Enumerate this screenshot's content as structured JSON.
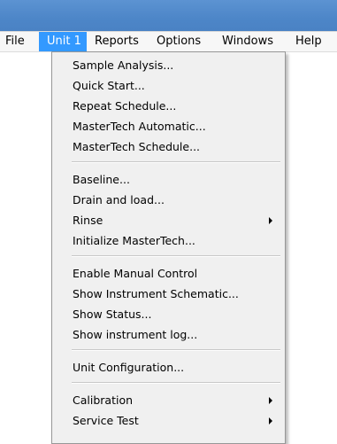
{
  "menubar": {
    "items": [
      {
        "label": "File"
      },
      {
        "label": "Unit 1"
      },
      {
        "label": "Reports"
      },
      {
        "label": "Options"
      },
      {
        "label": "Windows"
      },
      {
        "label": "Help"
      }
    ],
    "active_index": 1
  },
  "dropdown": {
    "items": [
      {
        "label": "Sample Analysis..."
      },
      {
        "label": "Quick Start..."
      },
      {
        "label": "Repeat Schedule..."
      },
      {
        "label": "MasterTech Automatic..."
      },
      {
        "label": "MasterTech Schedule..."
      },
      {
        "label": "Baseline..."
      },
      {
        "label": "Drain and load..."
      },
      {
        "label": "Rinse",
        "submenu": true
      },
      {
        "label": "Initialize MasterTech..."
      },
      {
        "label": "Enable Manual Control"
      },
      {
        "label": "Show Instrument Schematic..."
      },
      {
        "label": "Show Status..."
      },
      {
        "label": "Show instrument log..."
      },
      {
        "label": "Unit Configuration..."
      },
      {
        "label": "Calibration",
        "submenu": true
      },
      {
        "label": "Service Test",
        "submenu": true
      }
    ]
  },
  "colors": {
    "titlebar": "#4d86c8",
    "menu_highlight": "#3399ff",
    "menu_background": "#f0f0f0"
  }
}
